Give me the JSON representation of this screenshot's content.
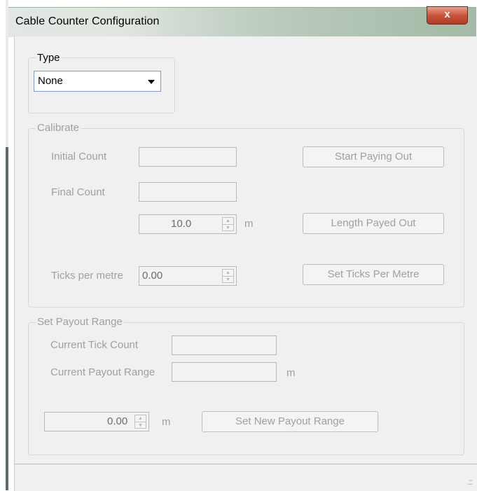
{
  "window": {
    "title": "Cable Counter Configuration",
    "close_label": "x"
  },
  "type_group": {
    "label": "Type",
    "selected": "None"
  },
  "calibrate": {
    "label": "Calibrate",
    "initial_count_label": "Initial Count",
    "initial_count_value": "",
    "final_count_label": "Final Count",
    "final_count_value": "",
    "length_value": "10.0",
    "length_unit": "m",
    "ticks_per_metre_label": "Ticks per metre",
    "ticks_per_metre_value": "0.00",
    "start_paying_out_label": "Start Paying Out",
    "length_payed_out_label": "Length Payed Out",
    "set_ticks_label": "Set Ticks Per Metre"
  },
  "payout": {
    "label": "Set Payout Range",
    "current_tick_label": "Current Tick Count",
    "current_tick_value": "",
    "current_range_label": "Current Payout Range",
    "current_range_value": "",
    "current_range_unit": "m",
    "new_value": "0.00",
    "new_unit": "m",
    "set_new_label": "Set New Payout Range"
  },
  "status": {
    "grip": ".::"
  }
}
